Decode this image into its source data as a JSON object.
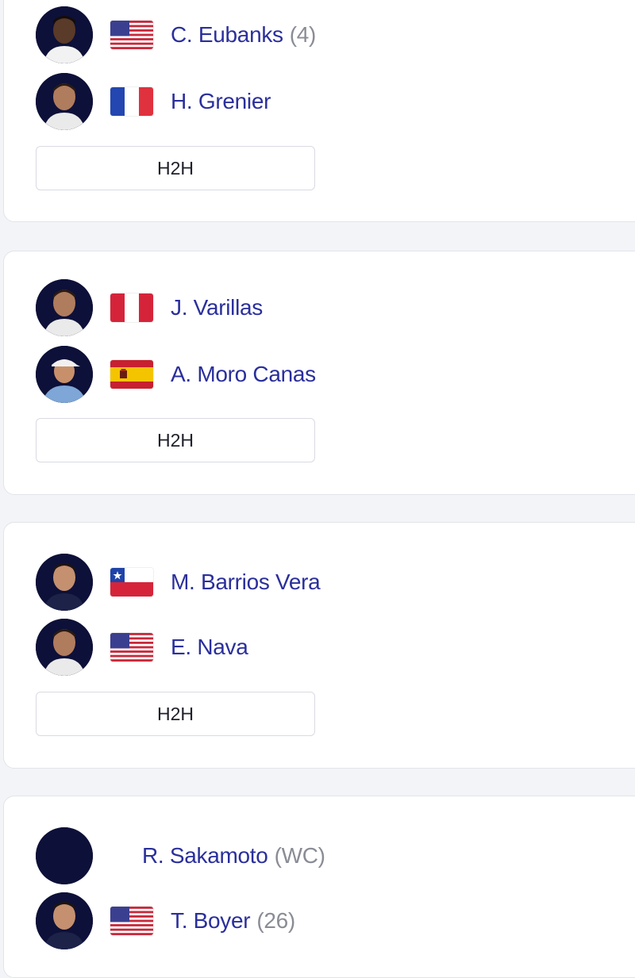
{
  "h2h_label": "H2H",
  "colors": {
    "player_name": "#2a2f9c",
    "seed_text": "#8a8c95",
    "avatar_bg": "#0d1038",
    "page_bg": "#f3f4f7"
  },
  "matches": [
    {
      "players": [
        {
          "name": "C. Eubanks",
          "seed": "(4)",
          "flag": "usa-flag"
        },
        {
          "name": "H. Grenier",
          "seed": "",
          "flag": "france-flag"
        }
      ]
    },
    {
      "players": [
        {
          "name": "J. Varillas",
          "seed": "",
          "flag": "peru-flag"
        },
        {
          "name": "A. Moro Canas",
          "seed": "",
          "flag": "spain-flag"
        }
      ]
    },
    {
      "players": [
        {
          "name": "M. Barrios Vera",
          "seed": "",
          "flag": "chile-flag"
        },
        {
          "name": "E. Nava",
          "seed": "",
          "flag": "usa-flag"
        }
      ]
    },
    {
      "players": [
        {
          "name": "R. Sakamoto",
          "seed": "(WC)",
          "flag": ""
        },
        {
          "name": "T. Boyer",
          "seed": "(26)",
          "flag": "usa-flag"
        }
      ]
    }
  ]
}
